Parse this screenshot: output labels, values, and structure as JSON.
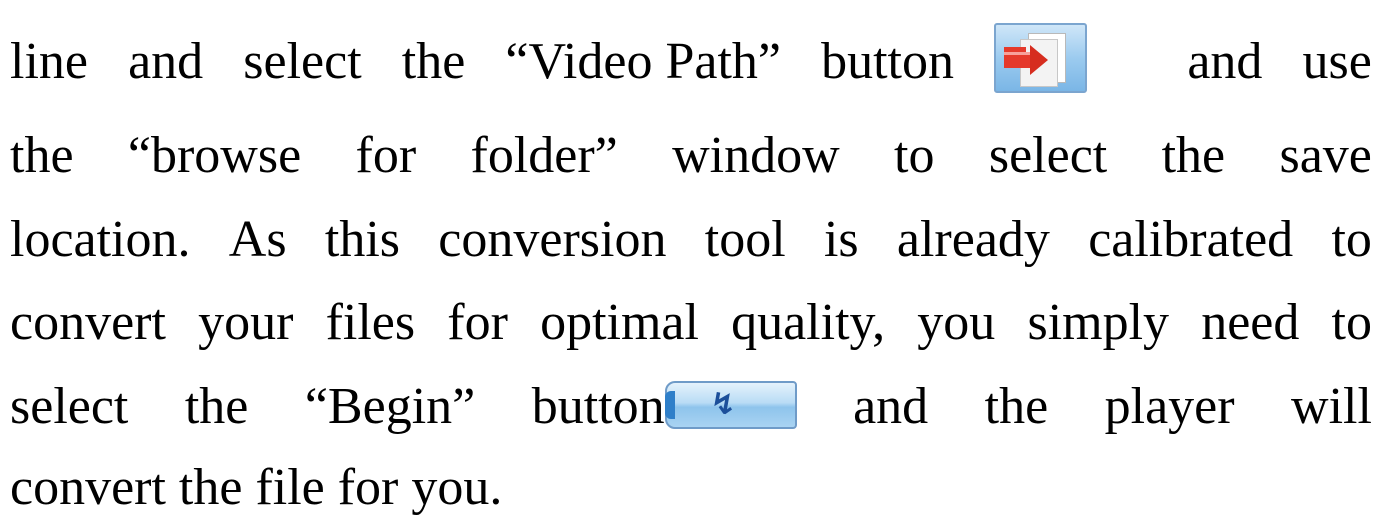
{
  "paragraph": {
    "line1": {
      "w1": "line",
      "w2": "and",
      "w3": "select",
      "w4": "the",
      "w5": "“Video Path”",
      "w6": "button",
      "w7": "and",
      "w8": "use"
    },
    "line2": {
      "w1": "the",
      "w2": "“browse",
      "w3": "for",
      "w4": "folder”",
      "w5": "window",
      "w6": "to",
      "w7": "select",
      "w8": "the",
      "w9": "save"
    },
    "line3": {
      "w1": "location.",
      "w2": "As",
      "w3": "this",
      "w4": "conversion",
      "w5": "tool",
      "w6": "is",
      "w7": "already",
      "w8": "calibrated",
      "w9": "to"
    },
    "line4": {
      "w1": "convert",
      "w2": "your",
      "w3": "files",
      "w4": "for",
      "w5": "optimal",
      "w6": "quality,",
      "w7": "you",
      "w8": "simply",
      "w9": "need",
      "w10": "to"
    },
    "line5": {
      "w1": "select",
      "w2": "the",
      "w3": "“Begin”",
      "w4": "button",
      "w5": "and",
      "w6": "the",
      "w7": "player",
      "w8": "will"
    },
    "line6": "convert the file for you."
  },
  "icons": {
    "video_path": "video-path-button-icon",
    "begin": "begin-button-icon"
  },
  "colors": {
    "text": "#000000",
    "icon_blue": "#9ccbef",
    "arrow_red": "#e5392b",
    "begin_glyph": "#1c4f9a"
  }
}
